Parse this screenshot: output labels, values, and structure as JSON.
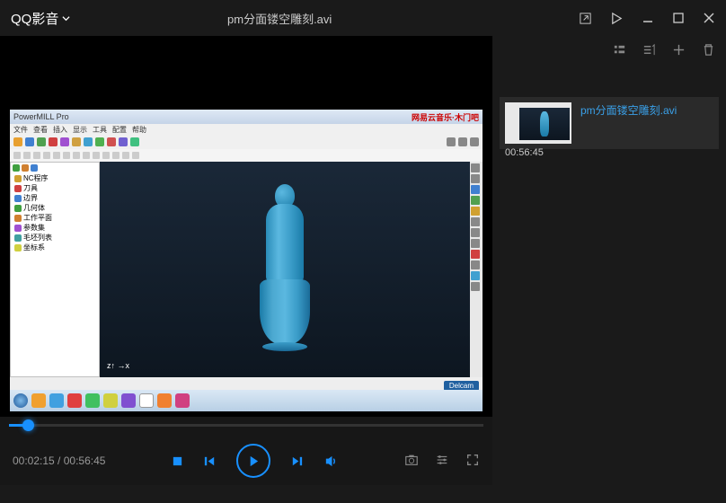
{
  "app": {
    "name": "QQ影音"
  },
  "header": {
    "file_title": "pm分面镂空雕刻.avi"
  },
  "playback": {
    "current_time": "00:02:15",
    "total_time": "00:56:45",
    "progress_percent": 4
  },
  "playlist": {
    "items": [
      {
        "name": "pm分面镂空雕刻.avi",
        "duration": "00:56:45"
      }
    ]
  },
  "video_content": {
    "app_window_title": "PowerMILL Pro",
    "corner_text": "网易云音乐·木门吧",
    "axis_label": "z↑ →x",
    "tree_items": [
      "NC程序",
      "刀具",
      "边界",
      "几何体",
      "工作平面",
      "参数集",
      "毛坯列表",
      "坐标系"
    ],
    "status_badge": "Delcam"
  },
  "colors": {
    "accent": "#1890ff",
    "link": "#3aa0e8"
  }
}
